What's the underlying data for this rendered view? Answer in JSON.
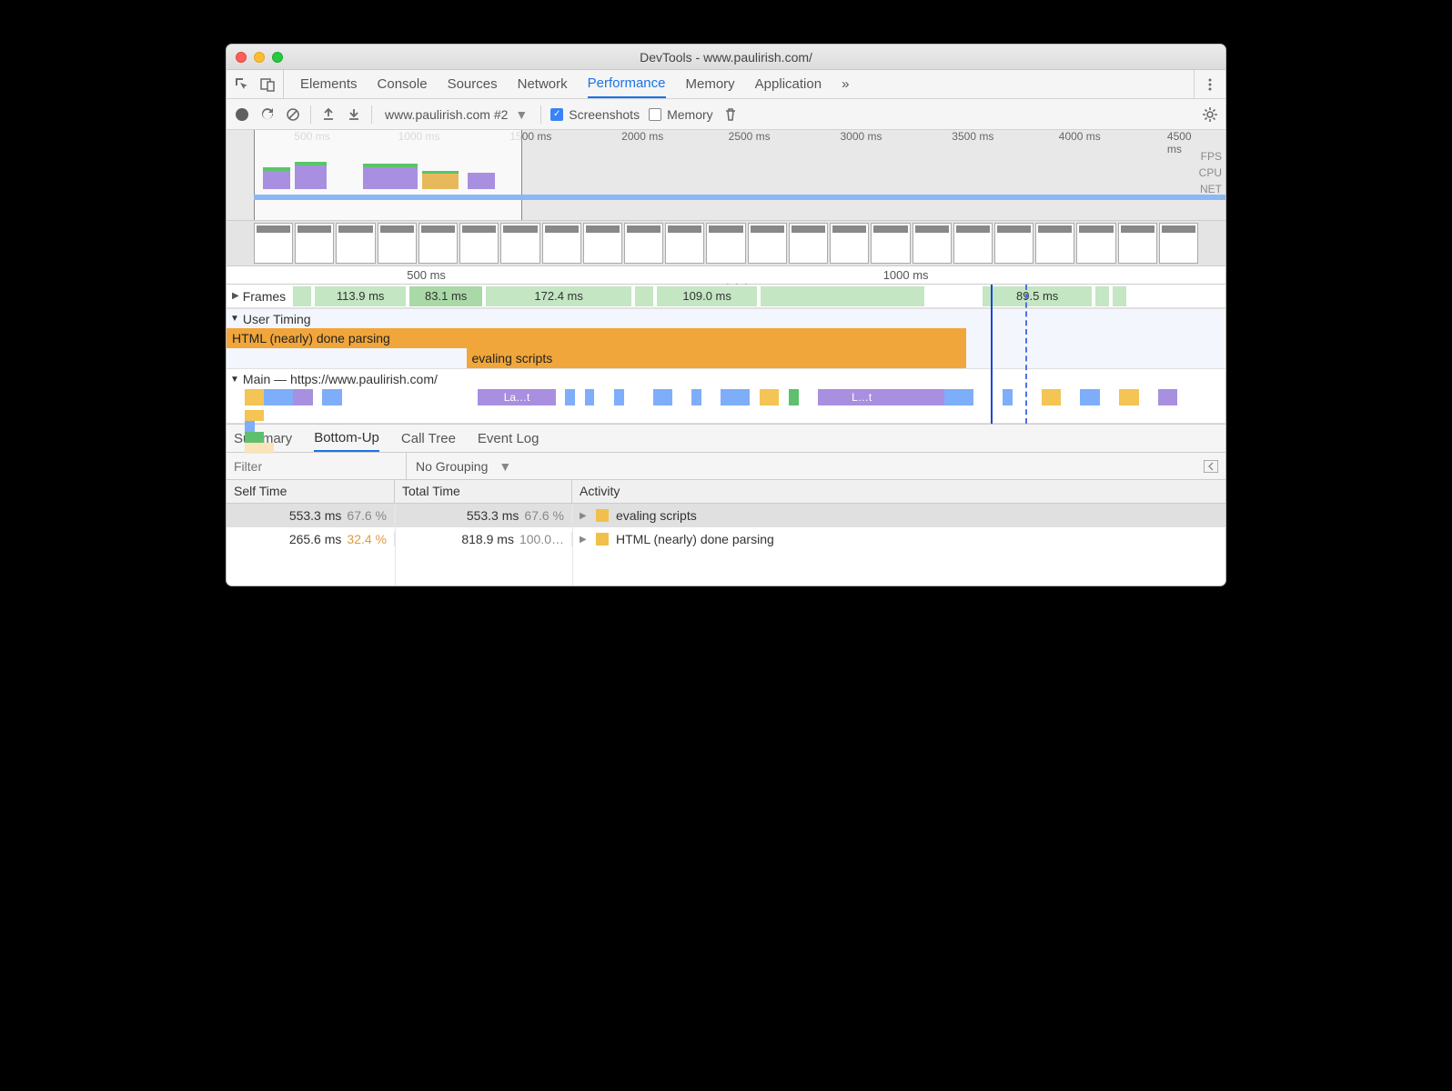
{
  "window": {
    "title": "DevTools - www.paulirish.com/"
  },
  "panels": {
    "items": [
      "Elements",
      "Console",
      "Sources",
      "Network",
      "Performance",
      "Memory",
      "Application"
    ],
    "active": "Performance",
    "overflow": "»"
  },
  "toolbar": {
    "recording_label": "www.paulirish.com #2",
    "screenshots_label": "Screenshots",
    "memory_label": "Memory",
    "screenshots_checked": true,
    "memory_checked": false
  },
  "overview": {
    "ticks": [
      "500 ms",
      "1000 ms",
      "1500 ms",
      "2000 ms",
      "2500 ms",
      "3000 ms",
      "3500 ms",
      "4000 ms",
      "4500 ms"
    ],
    "lanes": [
      "FPS",
      "CPU",
      "NET"
    ]
  },
  "ruler": {
    "ticks": [
      "500 ms",
      "1000 ms"
    ]
  },
  "frames": {
    "label": "Frames",
    "values": [
      "113.9 ms",
      "83.1 ms",
      "172.4 ms",
      "109.0 ms",
      "89.5 ms"
    ]
  },
  "user_timing": {
    "label": "User Timing",
    "bars": [
      "HTML (nearly) done parsing",
      "evaling scripts"
    ]
  },
  "main": {
    "label": "Main — https://www.paulirish.com/",
    "span_labels": [
      "La…t",
      "L…t"
    ]
  },
  "bottom_tabs": {
    "items": [
      "Summary",
      "Bottom-Up",
      "Call Tree",
      "Event Log"
    ],
    "active": "Bottom-Up"
  },
  "filter": {
    "placeholder": "Filter",
    "grouping": "No Grouping"
  },
  "table": {
    "headers": {
      "self": "Self Time",
      "total": "Total Time",
      "activity": "Activity"
    },
    "rows": [
      {
        "self_ms": "553.3 ms",
        "self_pct": "67.6 %",
        "total_ms": "553.3 ms",
        "total_pct": "67.6 %",
        "activity": "evaling scripts",
        "total_bar_pct": 67.6,
        "selected": true
      },
      {
        "self_ms": "265.6 ms",
        "self_pct": "32.4 %",
        "total_ms": "818.9 ms",
        "total_pct": "100.0…",
        "activity": "HTML (nearly) done parsing",
        "total_bar_pct": 100,
        "selected": false,
        "pct_orange": true
      }
    ]
  }
}
